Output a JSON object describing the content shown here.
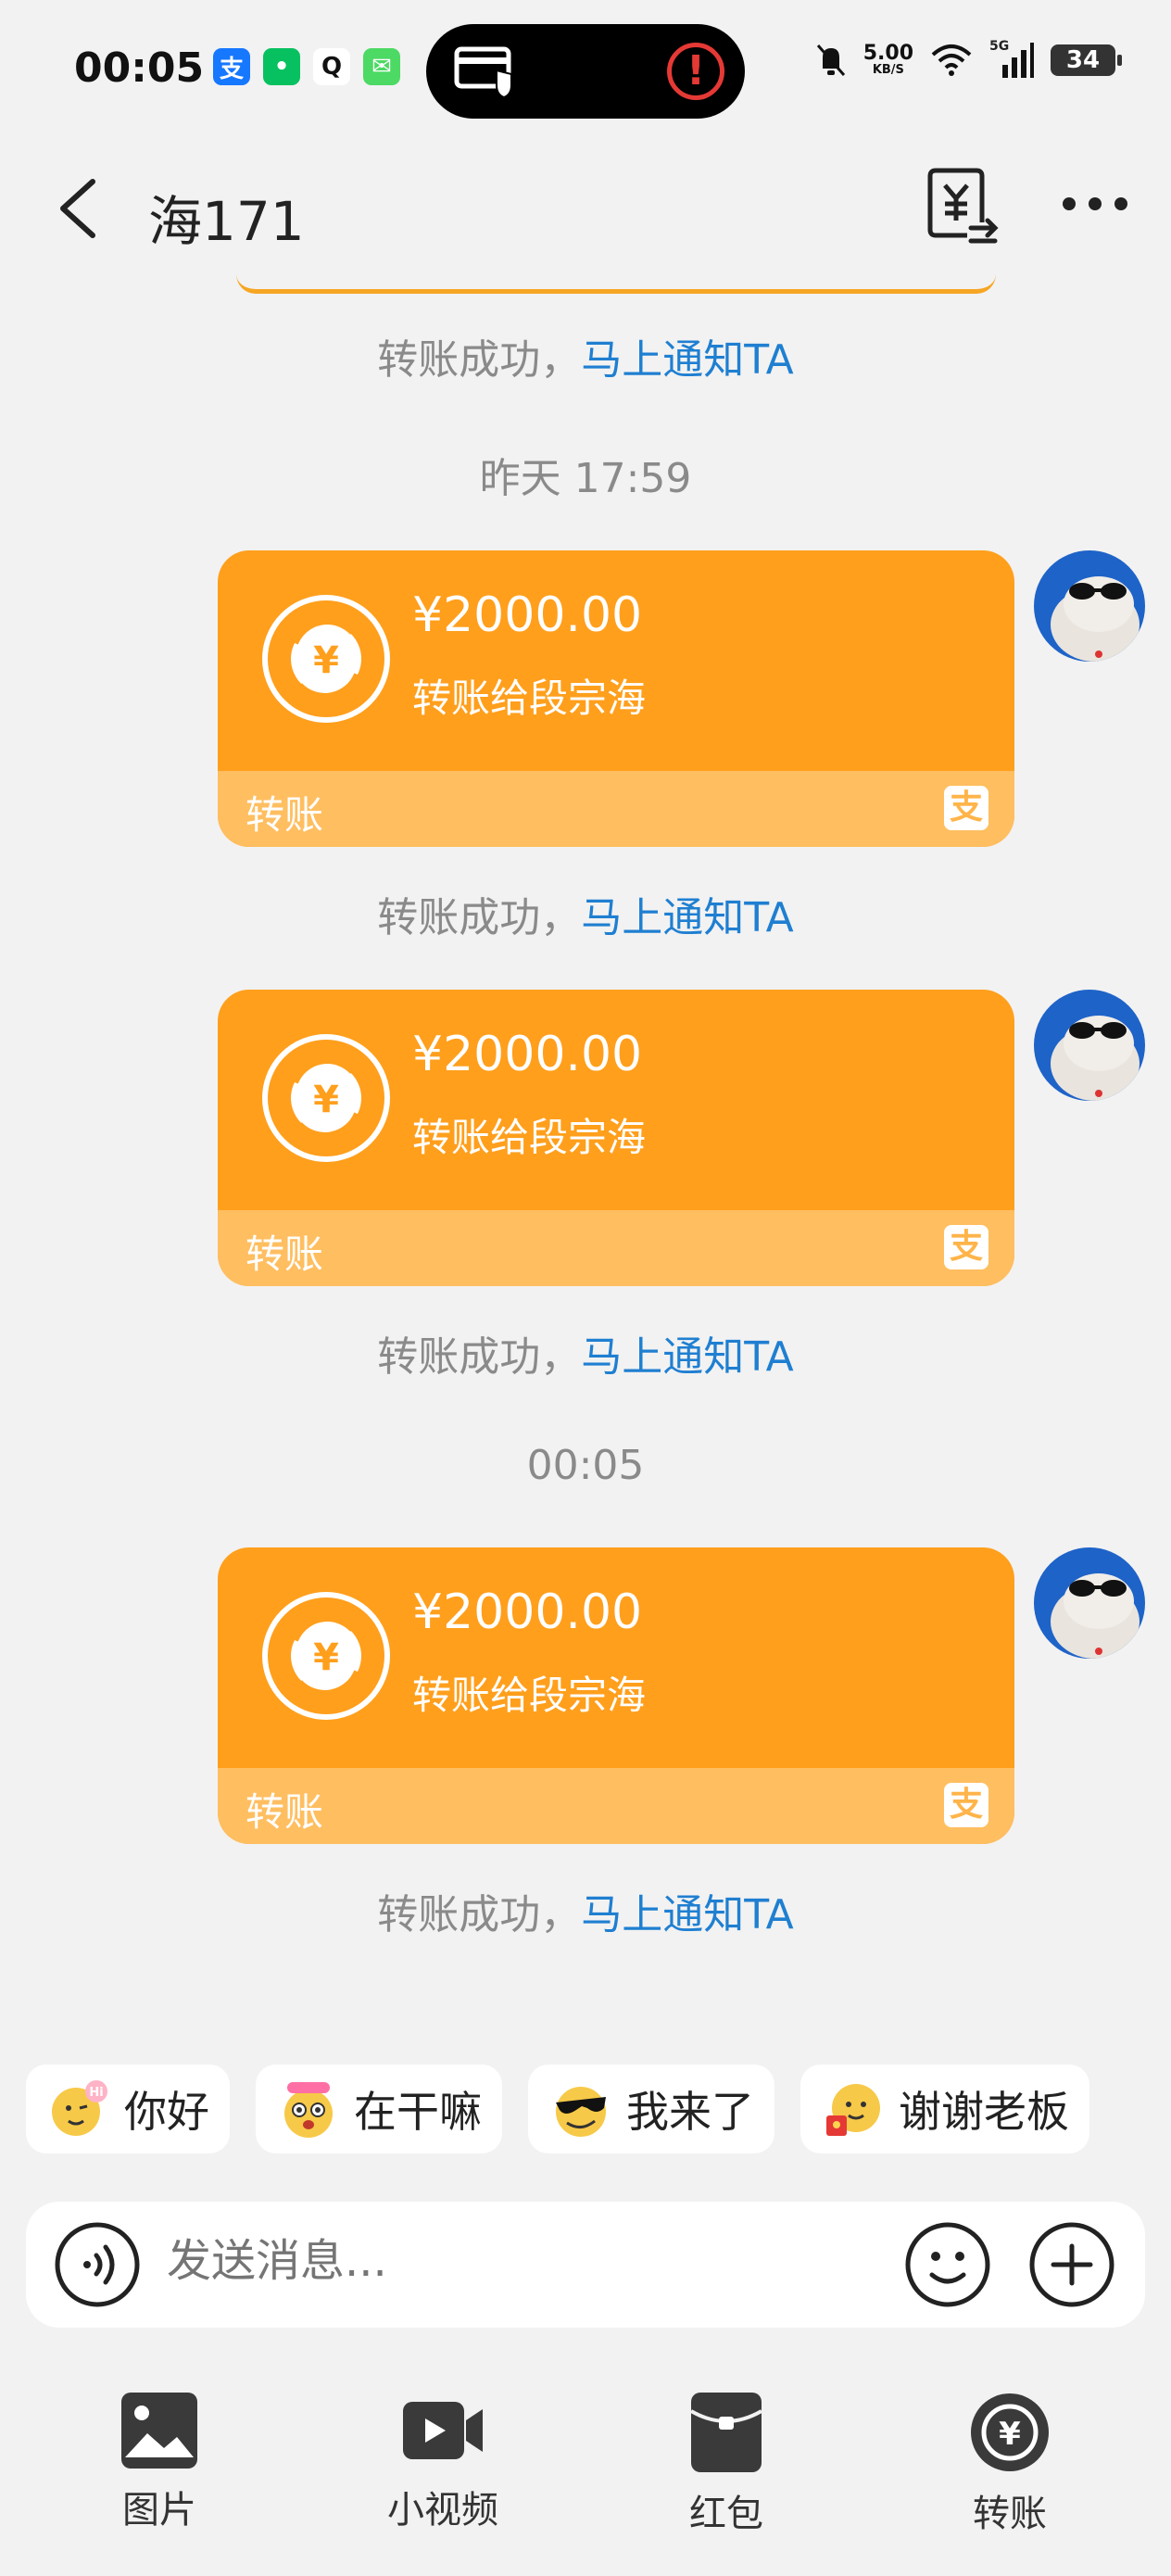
{
  "status_bar": {
    "time": "00:05",
    "apps": [
      {
        "icon": "alipay-icon",
        "glyph": "支",
        "color": "#1677ff"
      },
      {
        "icon": "wechat-icon",
        "glyph": "•",
        "color": "#07c160"
      },
      {
        "icon": "qq-icon",
        "glyph": "Q",
        "color": "#111111"
      },
      {
        "icon": "message-icon",
        "glyph": "✉",
        "color": "#4cd964"
      }
    ],
    "speed": "5.00",
    "speed_unit": "KB/S",
    "network": "5G",
    "battery": "34"
  },
  "header": {
    "title": "海171"
  },
  "messages": {
    "notify_prefix": "转账成功，",
    "notify_link": "马上通知TA",
    "timestamps": [
      "昨天 17:59",
      "00:05"
    ],
    "transfers": [
      {
        "amount": "¥2000.00",
        "desc": "转账给段宗海",
        "label": "转账",
        "logo": "支"
      },
      {
        "amount": "¥2000.00",
        "desc": "转账给段宗海",
        "label": "转账",
        "logo": "支"
      },
      {
        "amount": "¥2000.00",
        "desc": "转账给段宗海",
        "label": "转账",
        "logo": "支"
      }
    ]
  },
  "quick_replies": [
    {
      "text": "你好",
      "icon": "hi-emoji-icon"
    },
    {
      "text": "在干嘛",
      "icon": "surprised-emoji-icon"
    },
    {
      "text": "我来了",
      "icon": "sunglasses-emoji-icon"
    },
    {
      "text": "谢谢老板",
      "icon": "red-envelope-emoji-icon"
    }
  ],
  "input": {
    "placeholder": "发送消息..."
  },
  "actions": [
    {
      "label": "图片",
      "icon": "image-icon"
    },
    {
      "label": "小视频",
      "icon": "video-icon"
    },
    {
      "label": "红包",
      "icon": "red-packet-icon"
    },
    {
      "label": "转账",
      "icon": "transfer-icon"
    }
  ],
  "colors": {
    "card": "#ff9f1c",
    "card_footer": "#ffbe60",
    "link": "#1f7fd1",
    "background": "#f2f2f2"
  }
}
